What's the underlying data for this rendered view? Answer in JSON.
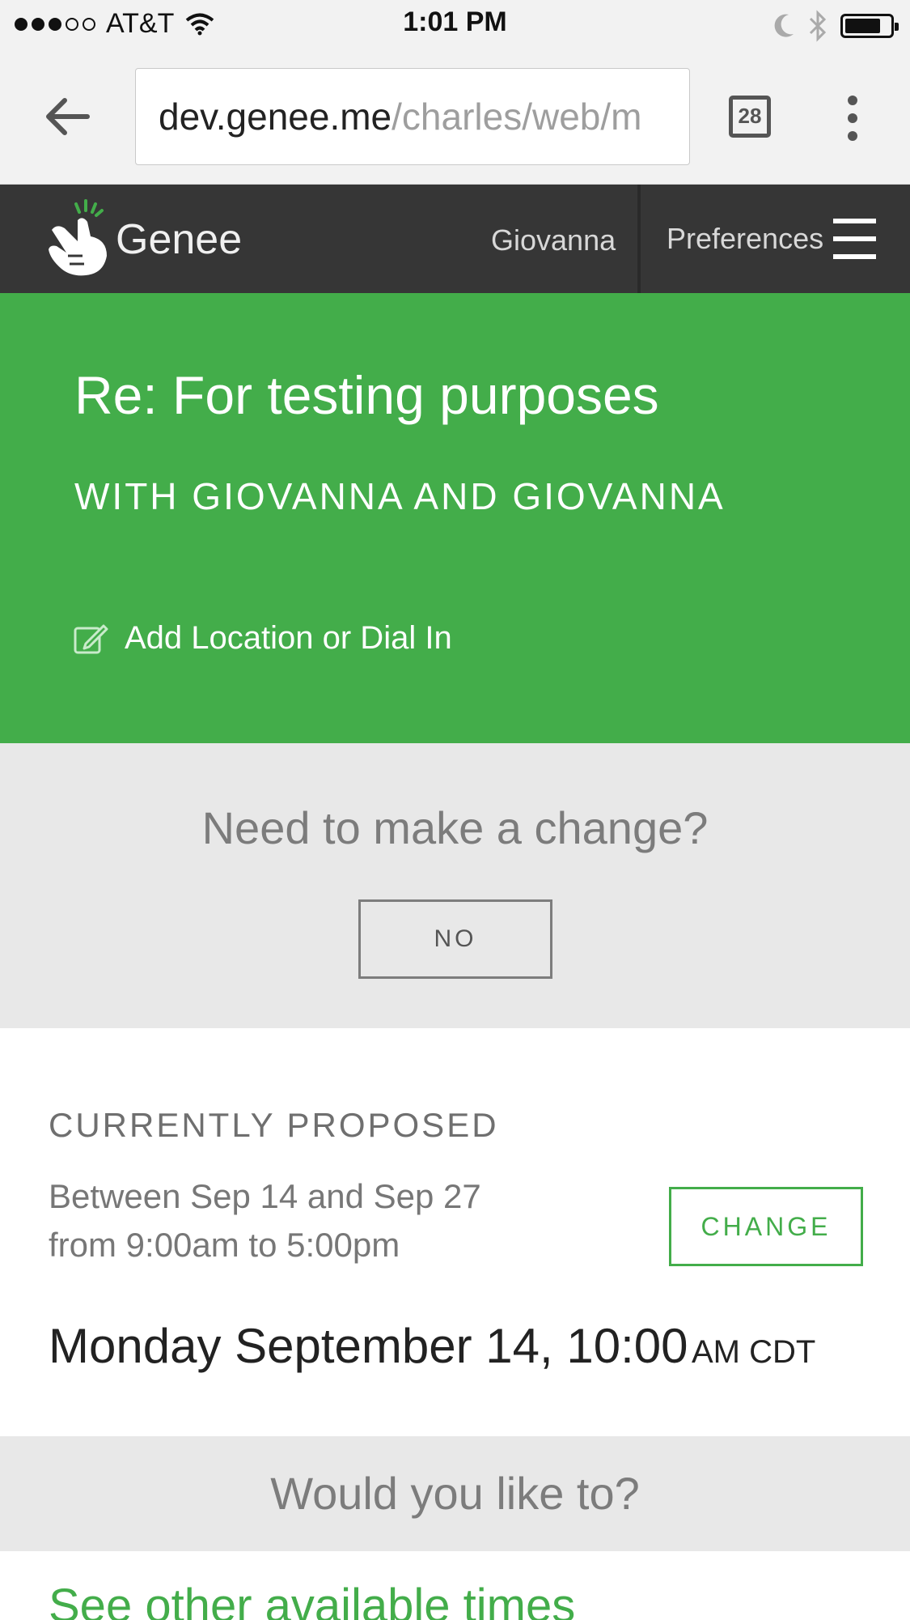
{
  "status_bar": {
    "carrier": "AT&T",
    "time": "1:01 PM",
    "signal_icon": "signal-dots-icon",
    "wifi_icon": "wifi-icon",
    "moon_icon": "moon-icon",
    "bluetooth_icon": "bluetooth-icon",
    "battery_icon": "battery-icon"
  },
  "browser": {
    "url_host": "dev.genee.me",
    "url_path": "/charles/web/m",
    "tab_count": "28",
    "back_icon": "back-arrow-icon",
    "menu_icon": "kebab-menu-icon"
  },
  "app_header": {
    "brand": "Genee",
    "user": "Giovanna",
    "preferences": "Preferences",
    "logo_icon": "genee-logo-icon",
    "menu_icon": "hamburger-menu-icon"
  },
  "hero": {
    "title": "Re: For testing purposes",
    "subtitle": "WITH GIOVANNA AND GIOVANNA",
    "add_location": "Add Location or Dial In",
    "edit_icon": "edit-icon",
    "background_color": "#43ad4a"
  },
  "change_section": {
    "question": "Need to make a change?",
    "no_label": "NO"
  },
  "proposed": {
    "heading": "CURRENTLY PROPOSED",
    "range_line1": "Between Sep 14 and Sep 27",
    "range_line2": "from 9:00am to 5:00pm",
    "change_label": "CHANGE",
    "datetime_main": "Monday September 14, 10:00",
    "datetime_suffix": "AM CDT"
  },
  "options": {
    "question": "Would you like to?",
    "see_other": "See other available times"
  }
}
